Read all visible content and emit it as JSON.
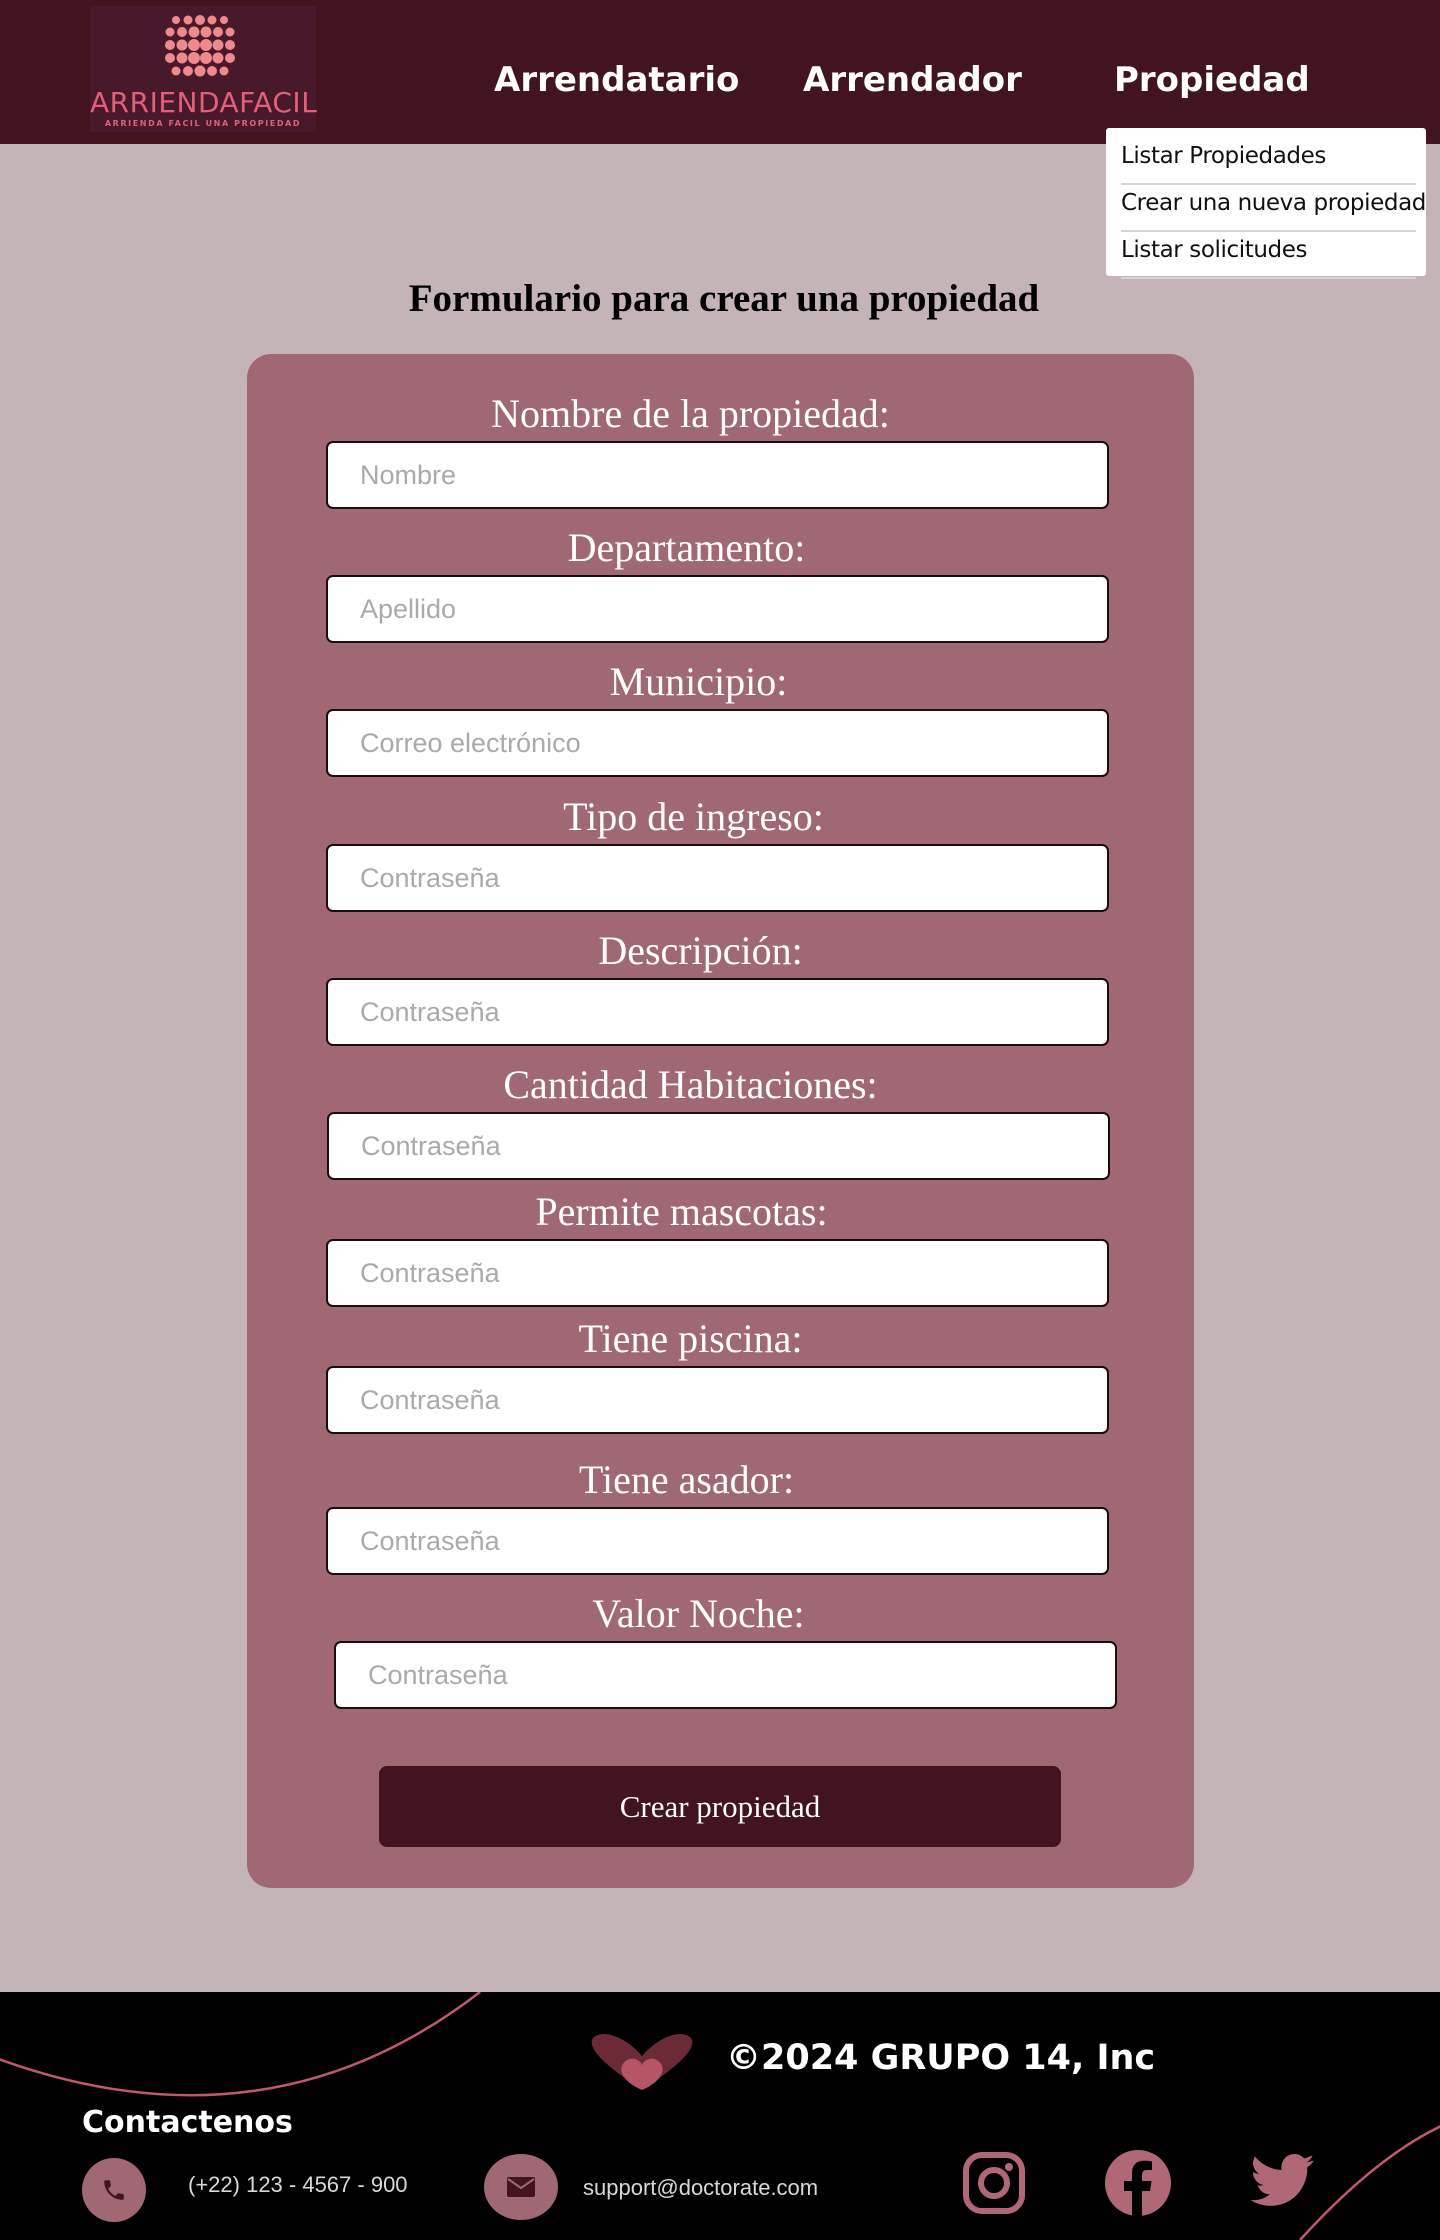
{
  "header": {
    "logo_name": "ARRIENDAFACIL",
    "logo_tagline": "ARRIENDA FACIL UNA PROPIEDAD",
    "nav": [
      {
        "label": "Arrendatario"
      },
      {
        "label": "Arrendador"
      },
      {
        "label": "Propiedad"
      }
    ],
    "dropdown": [
      {
        "label": "Listar Propiedades"
      },
      {
        "label": "Crear una nueva propiedad"
      },
      {
        "label": "Listar solicitudes"
      }
    ]
  },
  "main": {
    "title": "Formulario para crear una propiedad",
    "fields": [
      {
        "label": "Nombre de la propiedad:",
        "placeholder": "Nombre",
        "value": ""
      },
      {
        "label": "Departamento:",
        "placeholder": "Apellido",
        "value": ""
      },
      {
        "label": "Municipio:",
        "placeholder": "Correo electrónico",
        "value": ""
      },
      {
        "label": "Tipo de ingreso:",
        "placeholder": "Contraseña",
        "value": ""
      },
      {
        "label": "Descripción:",
        "placeholder": "Contraseña",
        "value": ""
      },
      {
        "label": "Cantidad Habitaciones:",
        "placeholder": "Contraseña",
        "value": ""
      },
      {
        "label": "Permite mascotas:",
        "placeholder": "Contraseña",
        "value": ""
      },
      {
        "label": "Tiene piscina:",
        "placeholder": "Contraseña",
        "value": ""
      },
      {
        "label": "Tiene asador:",
        "placeholder": "Contraseña",
        "value": ""
      },
      {
        "label": "Valor Noche:",
        "placeholder": "Contraseña",
        "value": ""
      }
    ],
    "submit_label": "Crear propiedad"
  },
  "footer": {
    "copyright": "©2024 GRUPO 14, Inc",
    "contact_title": "Contactenos",
    "phone": "(+22) 123 - 4567 - 900",
    "email": "support@doctorate.com",
    "icons": {
      "phone": "phone-icon",
      "email": "mail-icon",
      "instagram": "instagram-icon",
      "facebook": "facebook-icon",
      "twitter": "twitter-icon"
    }
  },
  "colors": {
    "header_bg": "#41141f",
    "page_bg": "#c4b4b8",
    "card_bg": "#a06872",
    "button_bg": "#41141f",
    "accent": "#e2607a",
    "footer_bg": "#000000"
  }
}
